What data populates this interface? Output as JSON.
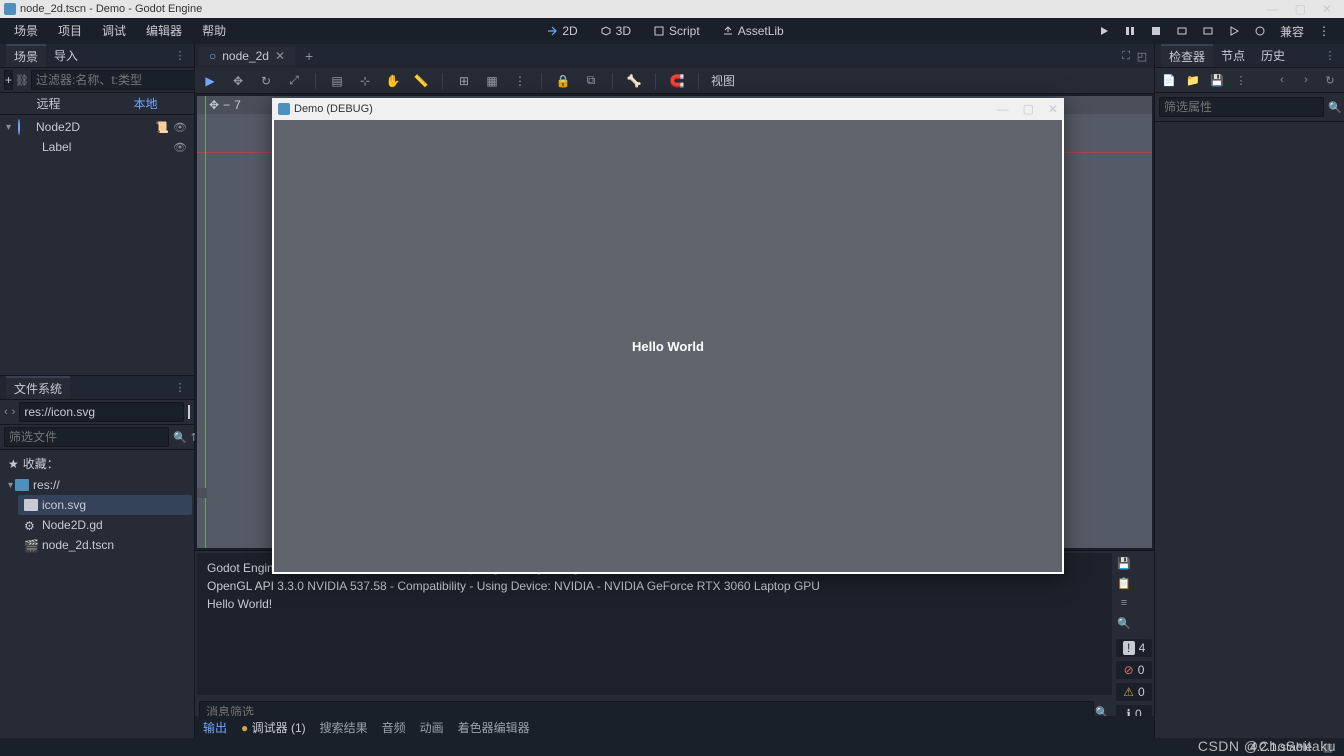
{
  "titlebar": {
    "text": "node_2d.tscn - Demo - Godot Engine"
  },
  "win_controls": {
    "min": "—",
    "max": "▢",
    "close": "✕"
  },
  "menubar": {
    "items": [
      "场景",
      "项目",
      "调试",
      "编辑器",
      "帮助"
    ],
    "center": {
      "v2d": "2D",
      "v3d": "3D",
      "script": "Script",
      "assetlib": "AssetLib"
    },
    "compat": "兼容"
  },
  "scene_panel": {
    "tab_scene": "场景",
    "tab_import": "导入",
    "filter_ph": "过滤器:名称、t:类型",
    "sub_remote": "远程",
    "sub_local": "本地",
    "root": "Node2D",
    "child": "Label"
  },
  "fs_panel": {
    "title": "文件系统",
    "path": "res://icon.svg",
    "filter_ph": "筛选文件",
    "fav": "收藏：",
    "root": "res://",
    "files": [
      "icon.svg",
      "Node2D.gd",
      "node_2d.tscn"
    ]
  },
  "center": {
    "tab": "node_2d",
    "view_label": "视图",
    "zoom": "7"
  },
  "bottom": {
    "lines": [
      "Godot Engine v4.2.1.stable.official.b09f793f5 - https://godotengine.org",
      "OpenGL API 3.3.0 NVIDIA 537.58 - Compatibility - Using Device: NVIDIA - NVIDIA GeForce RTX 3060 Laptop GPU",
      "",
      "Hello World!"
    ],
    "filter_ph": "消息筛选",
    "counts": {
      "info": "4",
      "err": "0",
      "warn": "0",
      "msg": "0"
    },
    "tabs": {
      "output": "输出",
      "debugger": "调试器 (1)",
      "search": "搜索结果",
      "audio": "音频",
      "anim": "动画",
      "shader": "着色器编辑器"
    }
  },
  "inspector": {
    "tab_inspect": "检查器",
    "tab_node": "节点",
    "tab_history": "历史",
    "filter_ph": "筛选属性"
  },
  "game": {
    "title": "Demo (DEBUG)",
    "hello": "Hello World"
  },
  "status": {
    "version": "4.2.1.stable"
  },
  "watermark": "CSDN @ChoSeitaku"
}
